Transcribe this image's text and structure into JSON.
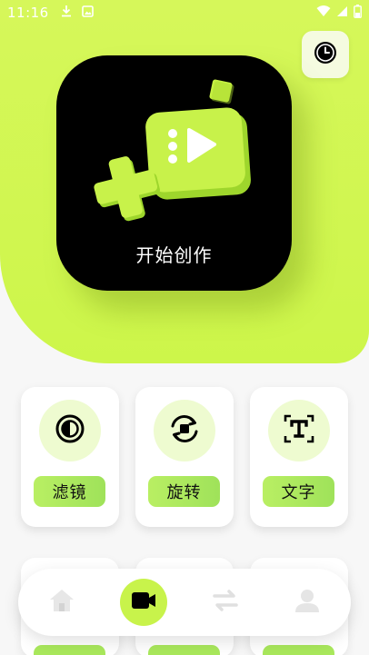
{
  "status_bar": {
    "time": "11:16",
    "icons": [
      "download-icon",
      "image-icon",
      "wifi-icon",
      "signal-icon",
      "battery-icon"
    ]
  },
  "header": {
    "history_icon": "clock-icon"
  },
  "create": {
    "label": "开始创作",
    "icon": "video-create-icon"
  },
  "tools": [
    {
      "label": "滤镜",
      "icon": "filter-icon"
    },
    {
      "label": "旋转",
      "icon": "rotate-icon"
    },
    {
      "label": "文字",
      "icon": "text-icon"
    }
  ],
  "bottom_nav": {
    "items": [
      {
        "icon": "home-icon",
        "active": false
      },
      {
        "icon": "video-camera-icon",
        "active": true
      },
      {
        "icon": "swap-icon",
        "active": false
      },
      {
        "icon": "profile-icon",
        "active": false
      }
    ]
  },
  "colors": {
    "accent": "#cdf64a",
    "accent_pill": "#a9e85c",
    "background": "#f7f7f7",
    "card_black": "#000000"
  }
}
